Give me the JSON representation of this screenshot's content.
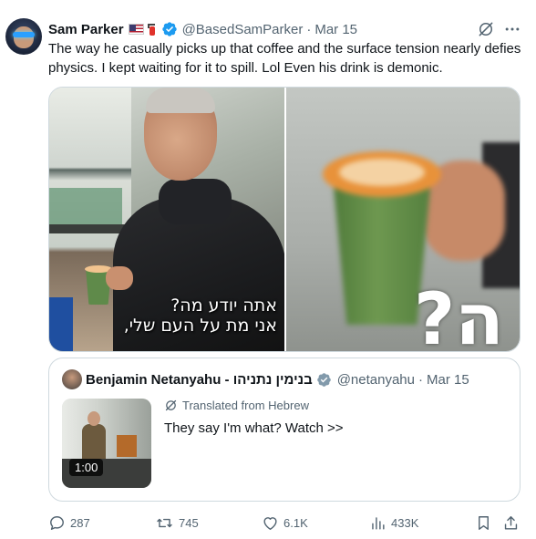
{
  "author": {
    "display_name": "Sam Parker",
    "handle": "@BasedSamParker",
    "date": "Mar 15"
  },
  "tweet": {
    "text": "The way he casually picks up that coffee and the surface tension nearly defies physics. I kept waiting for it to spill. Lol Even his drink is demonic."
  },
  "media": {
    "left_caption_line1": "אתה יודע מה?",
    "left_caption_line2": "אני מת על העם שלי,",
    "right_caption": "?ה"
  },
  "quoted": {
    "display_name": "Benjamin Netanyahu - בנימין נתניהו",
    "handle": "@netanyahu",
    "date": "Mar 15",
    "translated_label": "Translated from Hebrew",
    "text": "They say I'm what? Watch >>",
    "video_duration": "1:00"
  },
  "actions": {
    "replies": "287",
    "reposts": "745",
    "likes": "6.1K",
    "views": "433K"
  },
  "icons": [
    "verified-badge-icon",
    "us-flag-icon",
    "fire-extinguisher-icon",
    "grok-icon",
    "more-icon",
    "reply-icon",
    "repost-icon",
    "like-icon",
    "views-icon",
    "bookmark-icon",
    "share-icon",
    "translate-icon"
  ],
  "colors": {
    "text": "#0f1419",
    "muted": "#536471",
    "verified": "#1d9bf0",
    "border": "#cfd9de"
  }
}
